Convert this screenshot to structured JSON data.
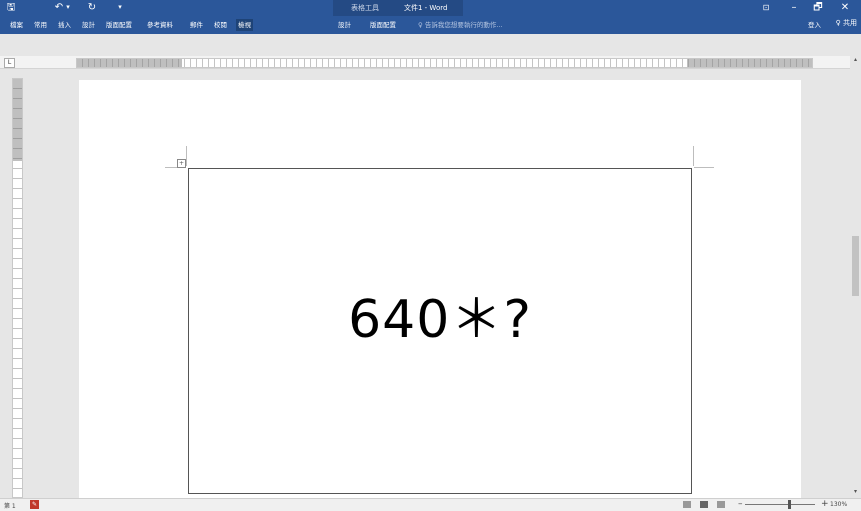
{
  "window": {
    "title": "文件1 - Word",
    "context_label": "表格工具",
    "controls": {
      "minimize": "–",
      "restore": "🗗",
      "close": "✕",
      "ribbon_display": "⊡"
    }
  },
  "quick_access": {
    "save": "🖫",
    "undo": "↶",
    "undo_more": "▾",
    "redo": "↻",
    "customize": "▾"
  },
  "ribbon": {
    "tabs": [
      {
        "label": "檔案"
      },
      {
        "label": "常用"
      },
      {
        "label": "插入"
      },
      {
        "label": "設計"
      },
      {
        "label": "版面配置"
      },
      {
        "label": "參考資料"
      },
      {
        "label": "郵件"
      },
      {
        "label": "校閱"
      },
      {
        "label": "檢視"
      },
      {
        "label": "設計"
      },
      {
        "label": "版面配置"
      }
    ],
    "active_tab_index": 8,
    "tell_me": "♀ 告訴我您想要執行的動作...",
    "sign_in": "登入",
    "share": "♀ 共用"
  },
  "document": {
    "cell_text": "640＊?"
  },
  "statusbar": {
    "page": "第 1",
    "zoom": "130%"
  },
  "colors": {
    "ribbon": "#2b579a",
    "context": "#244a84",
    "active_tab": "#1e4377"
  }
}
